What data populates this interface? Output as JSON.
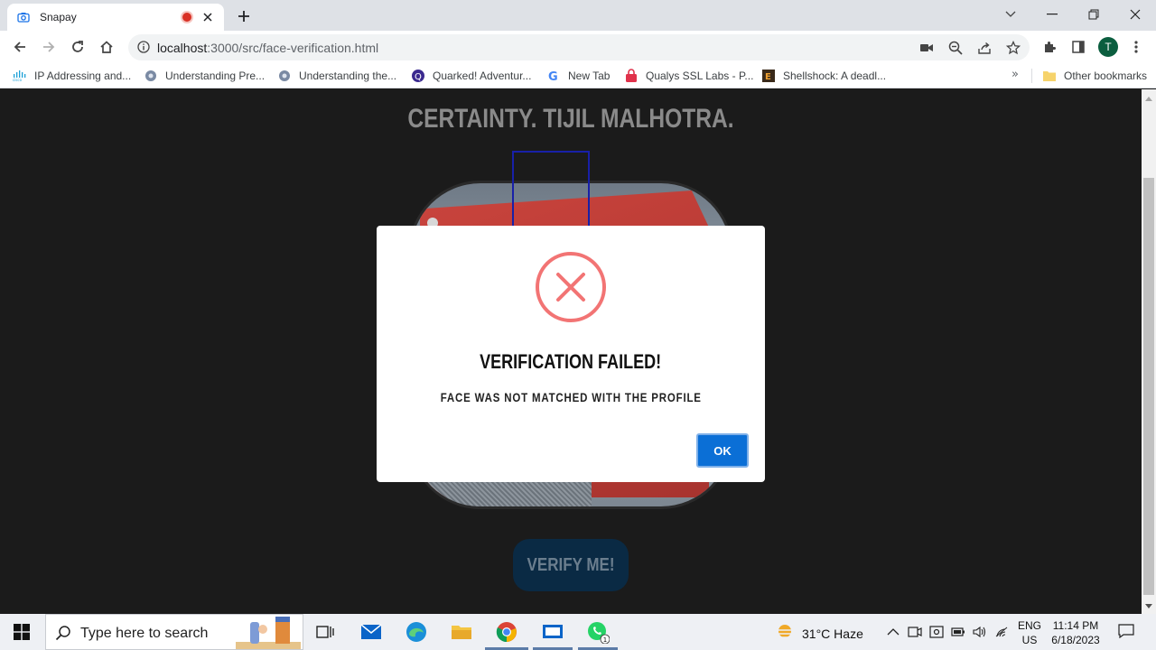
{
  "browser": {
    "tab_title": "Snapay",
    "url_host": "localhost",
    "url_rest": ":3000/src/face-verification.html",
    "profile_initial": "T",
    "bookmarks": [
      {
        "label": "IP Addressing and...",
        "icon": "cisco-icon"
      },
      {
        "label": "Understanding Pre...",
        "icon": "gear-badge-icon"
      },
      {
        "label": "Understanding the...",
        "icon": "gear-badge-icon"
      },
      {
        "label": "Quarked! Adventur...",
        "icon": "quarked-icon"
      },
      {
        "label": "New Tab",
        "icon": "google-icon"
      },
      {
        "label": "Qualys SSL Labs - P...",
        "icon": "qualys-icon"
      },
      {
        "label": "Shellshock: A deadl...",
        "icon": "shellshock-icon"
      }
    ],
    "more_bookmarks": "»",
    "other_bookmarks": "Other bookmarks"
  },
  "page": {
    "headline": "CERTAINTY. TIJIL MALHOTRA.",
    "verify_button": "VERIFY ME!"
  },
  "modal": {
    "title": "VERIFICATION FAILED!",
    "message": "FACE WAS NOT MATCHED WITH THE PROFILE",
    "ok_label": "OK",
    "error_color": "#f27474",
    "ok_color": "#0b6fd6"
  },
  "taskbar": {
    "search_placeholder": "Type here to search",
    "weather": "31°C  Haze",
    "lang_top": "ENG",
    "lang_bottom": "US",
    "time": "11:14 PM",
    "date": "6/18/2023",
    "whatsapp_badge": "1"
  }
}
